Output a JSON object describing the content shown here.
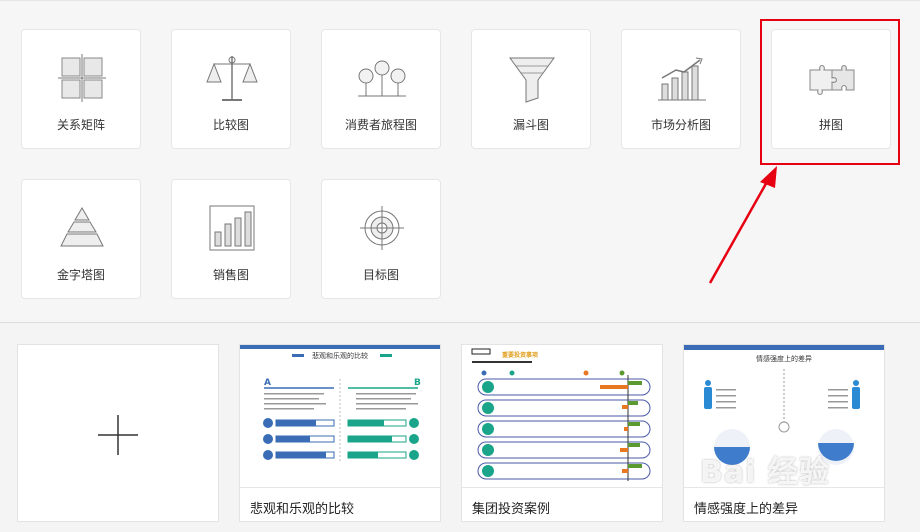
{
  "templates": [
    {
      "label": "关系矩阵",
      "icon": "matrix-icon"
    },
    {
      "label": "比较图",
      "icon": "balance-scale-icon"
    },
    {
      "label": "消费者旅程图",
      "icon": "journey-nodes-icon"
    },
    {
      "label": "漏斗图",
      "icon": "funnel-icon"
    },
    {
      "label": "市场分析图",
      "icon": "market-chart-icon"
    },
    {
      "label": "拼图",
      "icon": "puzzle-icon"
    },
    {
      "label": "金字塔图",
      "icon": "pyramid-icon"
    },
    {
      "label": "销售图",
      "icon": "sales-bar-icon"
    },
    {
      "label": "目标图",
      "icon": "target-icon"
    }
  ],
  "examples": [
    {
      "label": "",
      "icon": "plus-icon"
    },
    {
      "label": "悲观和乐观的比较",
      "thumb_title": "悲观和乐观的比较",
      "left_letter": "A",
      "right_letter": "B"
    },
    {
      "label": "集团投资案例",
      "thumb_title": "重要投资事项"
    },
    {
      "label": "情感强度上的差异",
      "thumb_title": "情感强度上的差异"
    }
  ],
  "watermark": "Bai 经验",
  "colors": {
    "highlight": "#e60012",
    "accent_blue": "#3a6db5",
    "accent_teal": "#1aa58a"
  }
}
